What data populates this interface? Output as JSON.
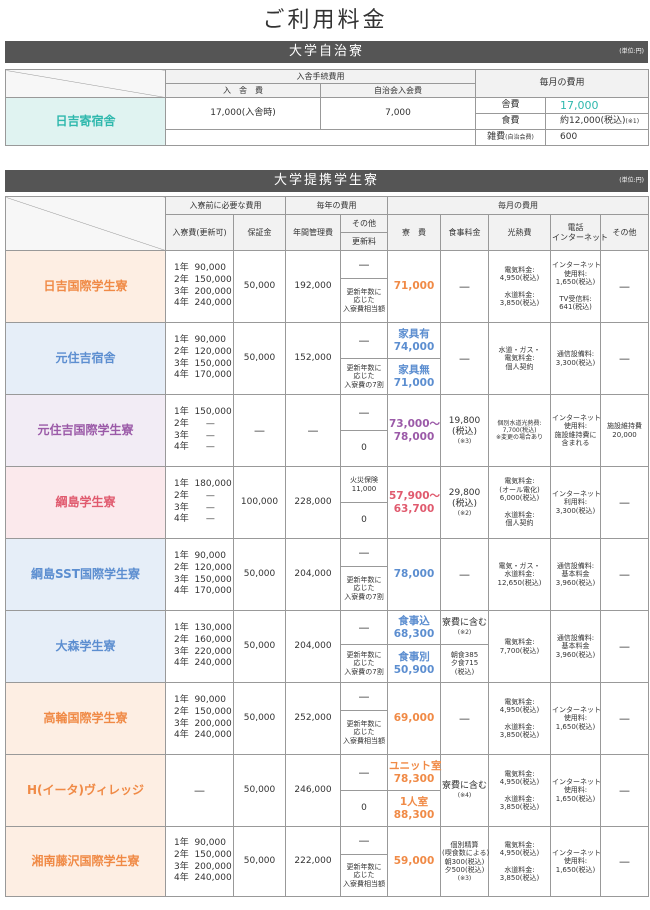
{
  "page_title": "ご利用料金",
  "unit": "(単位:円)",
  "sec1": {
    "title": "大学自治寮",
    "h_entry": "入舎手続費用",
    "h_nyusha": "入　舎　費",
    "h_jichi": "自治会入会費",
    "h_monthly": "毎月の費用",
    "dorm": "日吉寄宿舎",
    "nyusha": "17,000(入舎時)",
    "jichi": "7,000",
    "lbl_rent": "舎費",
    "rent": "17,000",
    "lbl_food": "食費",
    "food": "約12,000(税込)",
    "food_note": "(※1)",
    "lbl_misc": "雑費",
    "misc_note": "(自治会費)",
    "misc": "600"
  },
  "sec2": {
    "title": "大学提携学生寮",
    "h_before": "入寮前に必要な費用",
    "h_yearly": "毎年の費用",
    "h_monthly": "毎月の費用",
    "h_entry": "入寮費(更新可)",
    "h_deposit": "保証金",
    "h_annual": "年間管理費",
    "h_other": "その他",
    "h_renew": "更新料",
    "h_rent": "寮　費",
    "h_food": "食事料金",
    "h_util": "光熱費",
    "h_phone": "電話\nインターネット",
    "h_other2": "その他",
    "rows": [
      {
        "name": "日吉国際学生寮",
        "entry": "1年  90,000\n2年  150,000\n3年  200,000\n4年  240,000",
        "deposit": "50,000",
        "annual": "192,000",
        "other": "—",
        "renew": "更新年数に\n応じた\n入寮費相当額",
        "rent": "71,000",
        "food": "—",
        "util": "電気料金:\n4,950(税込)\n\n水道料金:\n3,850(税込)",
        "phone": "インターネット\n使用料:\n1,650(税込)\n\nTV受信料:\n641(税込)",
        "other2": "—"
      },
      {
        "name": "元住吉宿舎",
        "entry": "1年  90,000\n2年  120,000\n3年  150,000\n4年  170,000",
        "deposit": "50,000",
        "annual": "152,000",
        "other": "—",
        "renew": "更新年数に\n応じた\n入寮費の7割",
        "rent_a": "家具有\n74,000",
        "rent_b": "家具無\n71,000",
        "food": "—",
        "util": "水道・ガス・\n電気料金:\n個人契約",
        "phone": "通信設備料:\n3,300(税込)",
        "other2": "—"
      },
      {
        "name": "元住吉国際学生寮",
        "entry": "1年  150,000\n2年      —\n3年      —\n4年      —",
        "deposit": "—",
        "annual": "—",
        "other": "—",
        "renew": "0",
        "rent": "73,000〜\n78,000",
        "food": "19,800\n(税込)",
        "food_note": "(※3)",
        "util": "個別水道光熱費:\n7,700(税込)\n※変更の場合あり",
        "phone": "インターネット\n使用料:\n施設維持費に\n含まれる",
        "other2": "施設維持費\n20,000"
      },
      {
        "name": "綱島学生寮",
        "entry": "1年  180,000\n2年      —\n3年      —\n4年      —",
        "deposit": "100,000",
        "annual": "228,000",
        "other": "火災保険\n11,000",
        "renew": "0",
        "rent": "57,900〜\n63,700",
        "food": "29,800\n(税込)",
        "food_note": "(※2)",
        "util": "電気料金:\n(オール電化)\n6,000(税込)\n\n水道料金:\n個人契約",
        "phone": "インターネット\n利用料:\n3,300(税込)",
        "other2": "—"
      },
      {
        "name": "綱島SST国際学生寮",
        "entry": "1年  90,000\n2年  120,000\n3年  150,000\n4年  170,000",
        "deposit": "50,000",
        "annual": "204,000",
        "other": "—",
        "renew": "更新年数に\n応じた\n入寮費の7割",
        "rent": "78,000",
        "food": "—",
        "util": "電気・ガス・\n水道料金:\n12,650(税込)",
        "phone": "通信設備料:\n基本料金\n3,960(税込)",
        "other2": "—"
      },
      {
        "name": "大森学生寮",
        "entry": "1年  130,000\n2年  160,000\n3年  220,000\n4年  240,000",
        "deposit": "50,000",
        "annual": "204,000",
        "other": "—",
        "renew": "更新年数に\n応じた\n入寮費の7割",
        "rent_a": "食事込\n68,300",
        "rent_b": "食事別\n50,900",
        "food_a": "寮費に含む",
        "food_a_note": "(※2)",
        "food_b": "朝食385\n夕食715\n(税込)",
        "util": "電気料金:\n7,700(税込)",
        "phone": "通信設備料:\n基本料金\n3,960(税込)",
        "other2": "—"
      },
      {
        "name": "高輪国際学生寮",
        "entry": "1年  90,000\n2年  150,000\n3年  200,000\n4年  240,000",
        "deposit": "50,000",
        "annual": "252,000",
        "other": "—",
        "renew": "更新年数に\n応じた\n入寮費相当額",
        "rent": "69,000",
        "food": "—",
        "util": "電気料金:\n4,950(税込)\n\n水道料金:\n3,850(税込)",
        "phone": "インターネット\n使用料:\n1,650(税込)",
        "other2": "—"
      },
      {
        "name": "H(イータ)ヴィレッジ",
        "entry": "—",
        "deposit": "50,000",
        "annual": "246,000",
        "other": "—",
        "renew": "0",
        "rent_a": "ユニット室\n78,300",
        "rent_b": "1人室\n88,300",
        "food": "寮費に含む",
        "food_note": "(※4)",
        "util": "電気料金:\n4,950(税込)\n\n水道料金:\n3,850(税込)",
        "phone": "インターネット\n使用料:\n1,650(税込)",
        "other2": "—"
      },
      {
        "name": "湘南藤沢国際学生寮",
        "entry": "1年  90,000\n2年  150,000\n3年  200,000\n4年  240,000",
        "deposit": "50,000",
        "annual": "222,000",
        "other": "—",
        "renew": "更新年数に\n応じた\n入寮費相当額",
        "rent": "59,000",
        "food": "個別精算\n(喫食数による)\n朝300(税込)\n夕500(税込)",
        "food_note": "(※3)",
        "util": "電気料金:\n4,950(税込)\n\n水道料金:\n3,850(税込)",
        "phone": "インターネット\n使用料:\n1,650(税込)",
        "other2": "—"
      }
    ]
  }
}
